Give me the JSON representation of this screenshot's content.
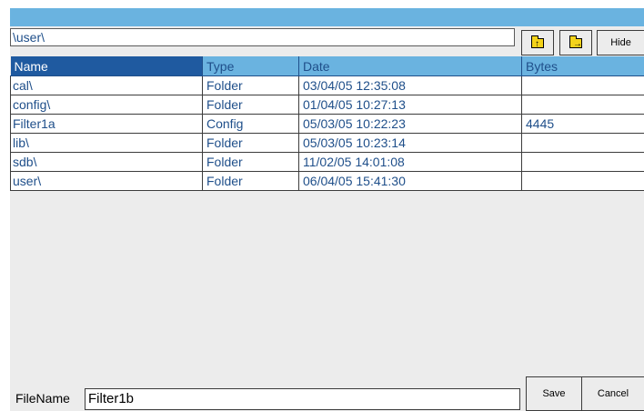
{
  "path": {
    "value": "\\user\\"
  },
  "toolbar": {
    "up_icon": "folder-up-icon",
    "new_icon": "folder-new-icon",
    "hide_label": "Hide"
  },
  "columns": [
    "Name",
    "Type",
    "Date",
    "Bytes"
  ],
  "rows": [
    {
      "name": "cal\\",
      "type": "Folder",
      "date": "03/04/05 12:35:08",
      "bytes": ""
    },
    {
      "name": "config\\",
      "type": "Folder",
      "date": "01/04/05 10:27:13",
      "bytes": ""
    },
    {
      "name": "Filter1a",
      "type": "Config",
      "date": "05/03/05 10:22:23",
      "bytes": "4445"
    },
    {
      "name": "lib\\",
      "type": "Folder",
      "date": "05/03/05 10:23:14",
      "bytes": ""
    },
    {
      "name": "sdb\\",
      "type": "Folder",
      "date": "11/02/05 14:01:08",
      "bytes": ""
    },
    {
      "name": "user\\",
      "type": "Folder",
      "date": "06/04/05 15:41:30",
      "bytes": ""
    }
  ],
  "footer": {
    "filename_label": "FileName",
    "filename_value": "Filter1b",
    "save_label": "Save",
    "cancel_label": "Cancel"
  },
  "colors": {
    "titlebar": "#6ab3e0",
    "header": "#6ab3e0",
    "header_selected": "#1f5aa0",
    "text": "#1f4f8a",
    "background": "#ececec"
  }
}
